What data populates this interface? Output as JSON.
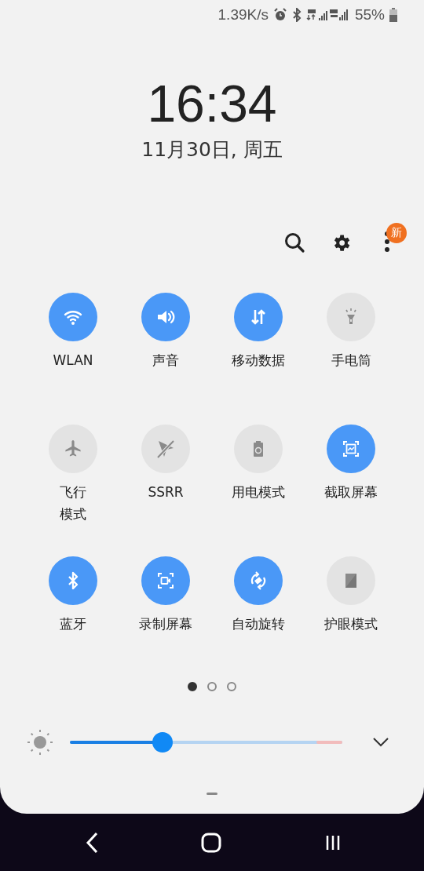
{
  "status_bar": {
    "net_speed": "1.39K/s",
    "battery": "55%"
  },
  "clock": {
    "time": "16:34",
    "date": "11月30日, 周五"
  },
  "toolbar": {
    "badge": "新"
  },
  "tiles": [
    {
      "label": "WLAN",
      "on": true
    },
    {
      "label": "声音",
      "on": true
    },
    {
      "label": "移动数据",
      "on": true
    },
    {
      "label": "手电筒",
      "on": false
    },
    {
      "label": [
        "飞行",
        "模式"
      ],
      "on": false
    },
    {
      "label": "SSRR",
      "on": false
    },
    {
      "label": "用电模式",
      "on": false
    },
    {
      "label": "截取屏幕",
      "on": true
    },
    {
      "label": "蓝牙",
      "on": true
    },
    {
      "label": "录制屏幕",
      "on": true
    },
    {
      "label": "自动旋转",
      "on": true
    },
    {
      "label": "护眼模式",
      "on": false
    }
  ],
  "pages": [
    {
      "selected": true
    },
    {
      "selected": false
    },
    {
      "selected": false
    }
  ],
  "brightness": {
    "level": 0.34
  }
}
